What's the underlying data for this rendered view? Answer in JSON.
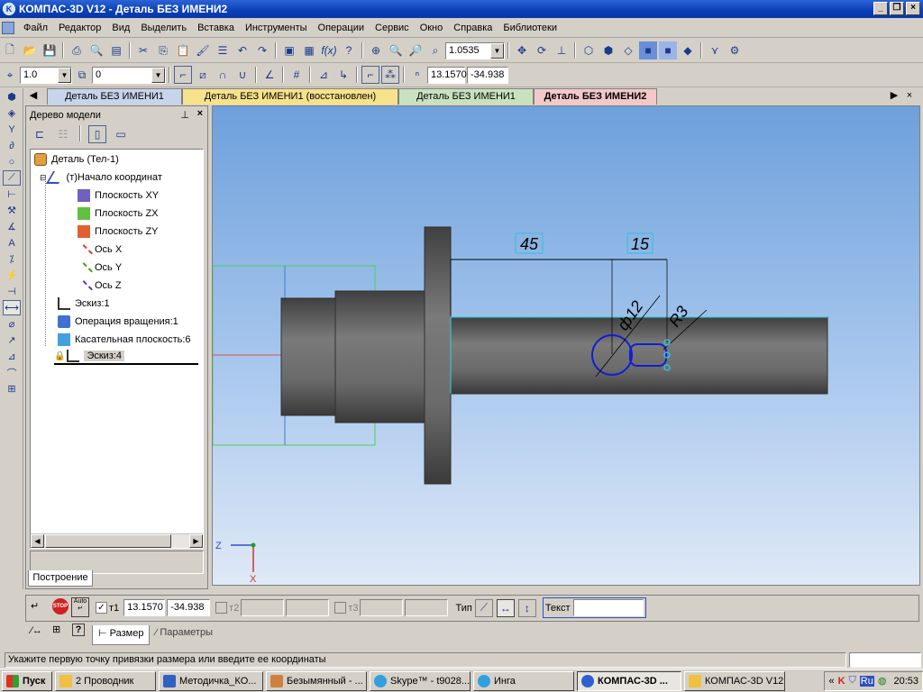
{
  "window": {
    "title": "КОМПАС-3D V12 - Деталь БЕЗ ИМЕНИ2",
    "app_icon": "kompas-logo-icon"
  },
  "menu": [
    "Файл",
    "Редактор",
    "Вид",
    "Выделить",
    "Вставка",
    "Инструменты",
    "Операции",
    "Сервис",
    "Окно",
    "Справка",
    "Библиотеки"
  ],
  "toolbar1": {
    "zoom_value": "1.0535"
  },
  "toolbar2": {
    "scale_value": "1.0",
    "layer_value": "0",
    "coord_x": "13.1570",
    "coord_y": "-34.938"
  },
  "tabs": [
    {
      "label": "Деталь БЕЗ ИМЕНИ1",
      "color": "#c8d4ec"
    },
    {
      "label": "Деталь БЕЗ ИМЕНИ1 (восстановлен)",
      "color": "#f6e28a"
    },
    {
      "label": "Деталь БЕЗ ИМЕНИ1",
      "color": "#c8e2c0"
    },
    {
      "label": "Деталь БЕЗ ИМЕНИ2",
      "color": "#f4c8c8"
    }
  ],
  "tree": {
    "title": "Дерево модели",
    "items": [
      {
        "label": "Деталь (Тел-1)",
        "icon": "part-icon"
      },
      {
        "label": "(т)Начало координат",
        "icon": "origin-icon"
      },
      {
        "label": "Плоскость XY",
        "icon": "plane-xy-icon"
      },
      {
        "label": "Плоскость ZX",
        "icon": "plane-zx-icon"
      },
      {
        "label": "Плоскость ZY",
        "icon": "plane-zy-icon"
      },
      {
        "label": "Ось X",
        "icon": "axis-x-icon"
      },
      {
        "label": "Ось Y",
        "icon": "axis-y-icon"
      },
      {
        "label": "Ось Z",
        "icon": "axis-z-icon"
      },
      {
        "label": "Эскиз:1",
        "icon": "sketch-icon"
      },
      {
        "label": "Операция вращения:1",
        "icon": "revolve-icon"
      },
      {
        "label": "Касательная плоскость:6",
        "icon": "tangent-plane-icon"
      },
      {
        "label": "Эскиз:4",
        "icon": "sketch-icon"
      }
    ],
    "bottom_tab": "Построение"
  },
  "drawing": {
    "dim1": "45",
    "dim2": "15",
    "dim_dia": "ф12",
    "dim_r": "R3",
    "axis_z": "Z",
    "axis_x": "X"
  },
  "props": {
    "t1_label": "т1",
    "t1_x": "13.1570",
    "t1_y": "-34.938",
    "t2_label": "т2",
    "t3_label": "т3",
    "type_label": "Тип",
    "text_label": "Текст",
    "tab_size": "Размер",
    "tab_params": "Параметры",
    "auto_label": "Auto",
    "stop_label": "STOP"
  },
  "status": "Укажите первую точку привязки размера или введите ее координаты",
  "taskbar": {
    "start": "Пуск",
    "buttons": [
      "2 Проводник",
      "Методичка_КО...",
      "Безымянный - ...",
      "Skype™ - t9028...",
      "Инга",
      "КОМПАС-3D ...",
      "КОМПАС-3D V12"
    ],
    "lang": "Ru",
    "time": "20:53"
  }
}
